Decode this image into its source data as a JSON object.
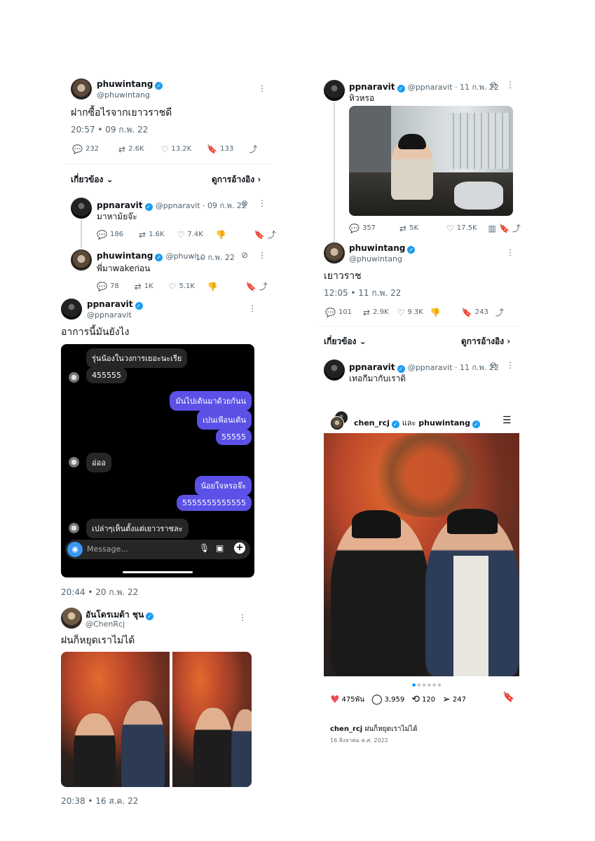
{
  "tweet1": {
    "name": "phuwintang",
    "handle": "@phuwintang",
    "text": "ฝากซื้อไรจากเยาวราชดี",
    "time": "20:57 • 09 ก.พ. 22",
    "stats": {
      "replies": "232",
      "retweets": "2.6K",
      "likes": "13.2K",
      "bookmarks": "133"
    },
    "related_label": "เกี่ยวข้อง",
    "quotes_label": "ดูการอ้างอิง"
  },
  "reply1": {
    "name": "ppnaravit",
    "handle": "@ppnaravit · 09 ก.พ. 22",
    "text": "มาหาม้ยจ๊ะ",
    "stats": {
      "replies": "186",
      "retweets": "1.6K",
      "likes": "7.4K"
    }
  },
  "reply2": {
    "name": "phuwintang",
    "handle": "@phuwi...",
    "date": "· 10 ก.พ. 22",
    "text": "พี่มาwakeก่อน",
    "stats": {
      "replies": "78",
      "retweets": "1K",
      "likes": "5.1K"
    }
  },
  "tweet2": {
    "name": "ppnaravit",
    "handle": "@ppnaravit",
    "text": "อาการนี้มันยังไง",
    "time": "20:44 • 20 ก.พ. 22"
  },
  "chat": {
    "messages": [
      {
        "side": "left",
        "text": "รุ่นน้องในวงการเยอะนะเรีย"
      },
      {
        "side": "left",
        "text": "455555"
      },
      {
        "side": "right",
        "text": "มันไปเต้นมาด้วยกันน"
      },
      {
        "side": "right",
        "text": "เปนเพือนเต้น"
      },
      {
        "side": "right",
        "text": "55555"
      },
      {
        "side": "left",
        "text": "อ่ออ"
      },
      {
        "side": "right",
        "text": "น้อยใจหรอจ๊ะ"
      },
      {
        "side": "right",
        "text": "5555555555555"
      },
      {
        "side": "left",
        "text": "เปล่าๆเห็นตั้งแต่เยาวราชละ"
      }
    ],
    "input_placeholder": "Message..."
  },
  "tweet3": {
    "name": "อันโดรเมด้า ชุน",
    "handle": "@ChenRcj",
    "text": "ฝนก็หยุดเราไม่ได้",
    "time": "20:38 • 16 ส.ค. 22"
  },
  "tweet4": {
    "name": "ppnaravit",
    "handle": "@ppnaravit · 11 ก.พ. 22",
    "text": "หิวหรอ",
    "stats": {
      "replies": "357",
      "retweets": "5K",
      "likes": "17.5K"
    }
  },
  "tweet5": {
    "name": "phuwintang",
    "handle": "@phuwintang",
    "text": "เยาวราช",
    "time": "12:05 • 11 ก.พ. 22",
    "stats": {
      "replies": "101",
      "retweets": "2.9K",
      "likes": "9.3K",
      "bookmarks": "243"
    },
    "related_label": "เกี่ยวข้อง",
    "quotes_label": "ดูการอ้างอิง"
  },
  "reply3": {
    "name": "ppnaravit",
    "handle": "@ppnaravit · 11 ก.พ. 22",
    "text": "เทอกีมากับเราดิ"
  },
  "ig": {
    "users": "chen_rcj",
    "joiner": "และ",
    "user2": "phuwintang",
    "likes": "475พัน",
    "comments": "3,959",
    "reposts": "120",
    "shares": "247",
    "caption_user": "chen_rcj",
    "caption": "ฝนก็หยุดเราไม่ได้",
    "date": "16 สิงหาคม ค.ศ. 2022"
  },
  "colors": {
    "verified": "#1d9bf0",
    "chat_bubble_right": "#5b51e6",
    "heart": "#ed4956"
  }
}
